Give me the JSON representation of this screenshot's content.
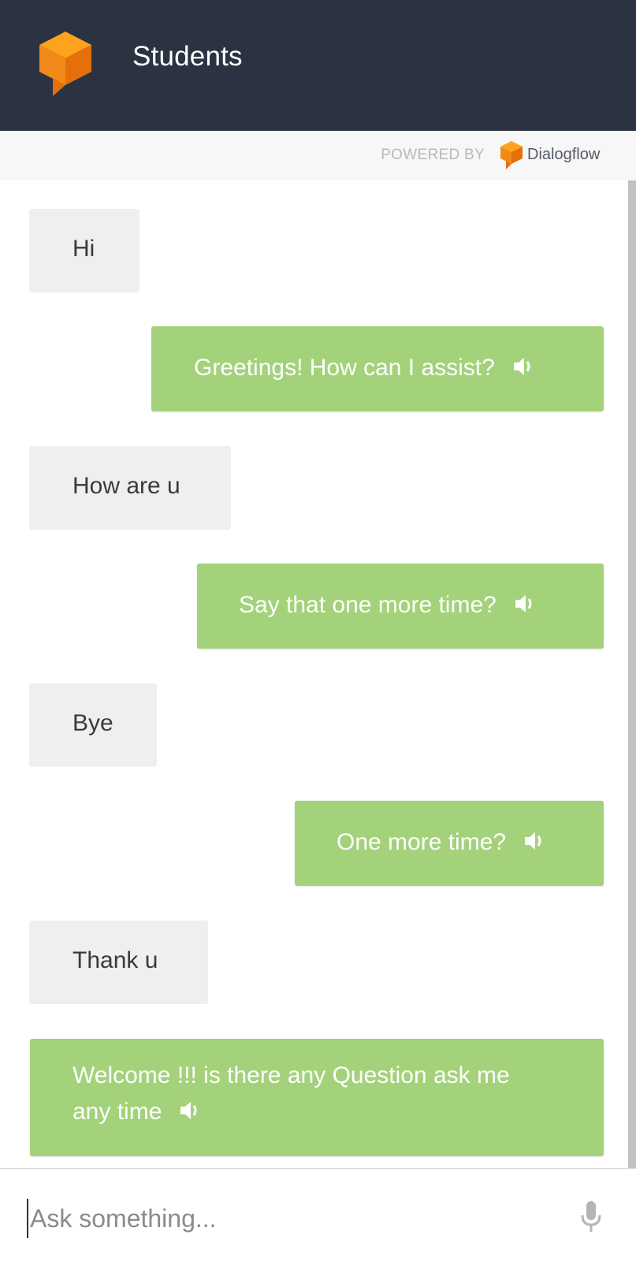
{
  "header": {
    "title": "Students"
  },
  "powered_by": {
    "label": "POWERED BY",
    "brand": "Dialogflow"
  },
  "messages": [
    {
      "from": "user",
      "text": "Hi"
    },
    {
      "from": "bot",
      "text": "Greetings! How can I assist?",
      "icon": "speaker-icon"
    },
    {
      "from": "user",
      "text": "How are u"
    },
    {
      "from": "bot",
      "text": "Say that one more time?",
      "icon": "speaker-icon"
    },
    {
      "from": "user",
      "text": "Bye"
    },
    {
      "from": "bot",
      "text": "One more time?",
      "icon": "speaker-icon"
    },
    {
      "from": "user",
      "text": "Thank u"
    },
    {
      "from": "bot",
      "text_line1": "Welcome !!! is there any Question ask me",
      "text_line2": "any time",
      "icon": "speaker-icon"
    }
  ],
  "composer": {
    "placeholder": "Ask something...",
    "mic_icon": "microphone-icon"
  },
  "colors": {
    "header_bg": "#2b3241",
    "brand_orange": "#f28a19",
    "bot_bubble": "#a3d27a",
    "user_bubble": "#efefef"
  }
}
